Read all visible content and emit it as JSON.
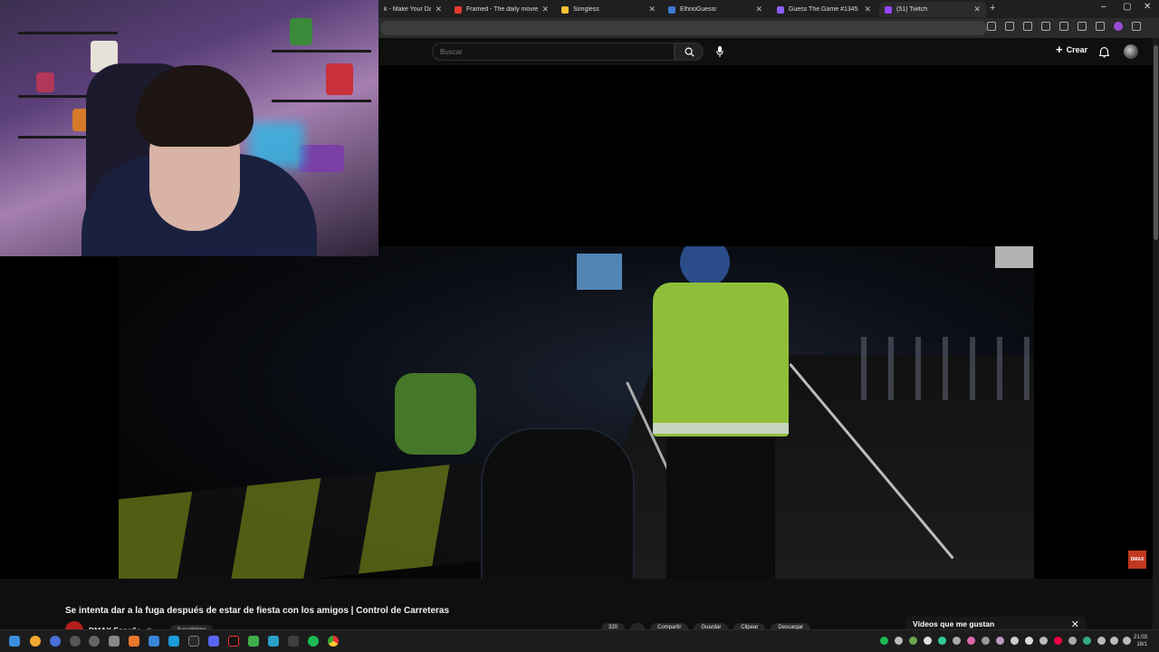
{
  "browser": {
    "tabs": [
      {
        "label": "k - Make Your Day",
        "icon_color": "#e6e6e6"
      },
      {
        "label": "Framed - The daily movie guess",
        "icon_color": "#e33b2e"
      },
      {
        "label": "Songless",
        "icon_color": "#f2c230"
      },
      {
        "label": "ElhnoGuessr",
        "icon_color": "#3a7bd5"
      },
      {
        "label": "Guess The.Game #1345",
        "icon_color": "#8a5cf5"
      },
      {
        "label": "(51) Twitch",
        "icon_color": "#9146ff"
      }
    ],
    "new_tab_label": "+",
    "window_controls": [
      "–",
      "▢",
      "✕"
    ]
  },
  "youtube_header": {
    "search_placeholder": "Buscar",
    "create_label": "Crear"
  },
  "video": {
    "title": "Se intenta dar a la fuga después de estar de fiesta con los amigos | Control de Carreteras",
    "channel_name": "DMAX España",
    "channel_logo_text": "DMAX",
    "watermark_text": "DMAX",
    "subscribe_label": "Suscribirme",
    "action_labels": [
      "320",
      "",
      "Compartir",
      "Guardar",
      "Clipear",
      "Descargar"
    ]
  },
  "sidebar_panel": {
    "liked_title": "Vídeos que me gustan"
  },
  "taskbar": {
    "time": "21:03",
    "date": "18/1"
  },
  "colors": {
    "youtube_bg": "#0f0f0f",
    "dmax_red": "#c0391f",
    "twitch_purple": "#9146ff"
  }
}
